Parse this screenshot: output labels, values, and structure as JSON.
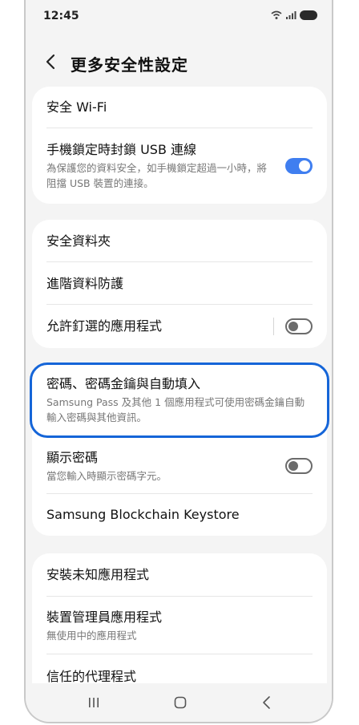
{
  "status_bar": {
    "time": "12:45"
  },
  "header": {
    "title": "更多安全性設定"
  },
  "group1": [
    {
      "label": "安全 Wi-Fi"
    },
    {
      "label": "手機鎖定時封鎖 USB 連線",
      "sub": "為保護您的資料安全，如手機鎖定超過一小時，將阻擋 USB 裝置的連接。",
      "toggle": "on"
    }
  ],
  "group2": [
    {
      "label": "安全資料夾"
    },
    {
      "label": "進階資料防護"
    },
    {
      "label": "允許釘選的應用程式",
      "toggle": "off"
    }
  ],
  "group3": [
    {
      "label": "密碼、密碼金鑰與自動填入",
      "sub": "Samsung Pass 及其他 1 個應用程式可使用密碼金鑰自動輸入密碼與其他資訊。"
    },
    {
      "label": "顯示密碼",
      "sub": "當您輸入時顯示密碼字元。",
      "toggle": "off"
    },
    {
      "label": "Samsung Blockchain Keystore"
    }
  ],
  "group4": [
    {
      "label": "安裝未知應用程式"
    },
    {
      "label": "裝置管理員應用程式",
      "sub": "無使用中的應用程式"
    },
    {
      "label": "信任的代理程式"
    }
  ],
  "colors": {
    "accent": "#3f7ef0",
    "highlight": "#1565d8",
    "background": "#f4f4f4"
  },
  "icons": {
    "back": "chevron-left-icon",
    "recents": "recents-icon",
    "home": "home-icon",
    "nav_back": "nav-back-icon"
  }
}
